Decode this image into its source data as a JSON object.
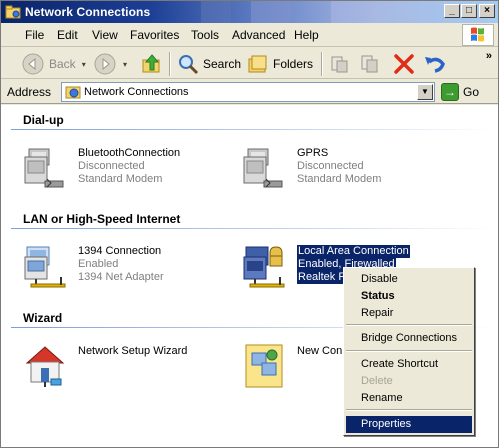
{
  "window": {
    "title": "Network Connections",
    "controls": {
      "minimize": "_",
      "maximize": "□",
      "close": "×"
    }
  },
  "menubar": {
    "items": [
      "File",
      "Edit",
      "View",
      "Favorites",
      "Tools",
      "Advanced",
      "Help"
    ]
  },
  "toolbar": {
    "back_label": "Back",
    "search_label": "Search",
    "folders_label": "Folders",
    "overflow": "»"
  },
  "address": {
    "label": "Address",
    "value": "Network Connections",
    "go_label": "Go"
  },
  "groups": {
    "dialup": {
      "header": "Dial-up",
      "items": [
        {
          "name": "BluetoothConnection",
          "status": "Disconnected",
          "device": "Standard Modem"
        },
        {
          "name": "GPRS",
          "status": "Disconnected",
          "device": "Standard Modem"
        }
      ]
    },
    "lan": {
      "header": "LAN or High-Speed Internet",
      "items": [
        {
          "name": "1394 Connection",
          "status": "Enabled",
          "device": "1394 Net Adapter"
        },
        {
          "name": "Local Area Connection",
          "status": "Enabled, Firewalled",
          "device": "Realtek R"
        }
      ]
    },
    "wizard": {
      "header": "Wizard",
      "items": [
        {
          "name": "Network Setup Wizard"
        },
        {
          "name": "New Conn"
        }
      ]
    }
  },
  "context_menu": {
    "items": [
      {
        "label": "Disable",
        "state": "normal"
      },
      {
        "label": "Status",
        "state": "default"
      },
      {
        "label": "Repair",
        "state": "normal"
      },
      {
        "label": "Bridge Connections",
        "state": "normal"
      },
      {
        "label": "Create Shortcut",
        "state": "normal"
      },
      {
        "label": "Delete",
        "state": "disabled"
      },
      {
        "label": "Rename",
        "state": "normal"
      },
      {
        "label": "Properties",
        "state": "highlighted"
      }
    ]
  },
  "colors": {
    "selection": "#0a246a",
    "title_gradient_start": "#0a246a",
    "group_line": "#7c9ed9",
    "window_bg": "#ece9d8"
  },
  "icons": {
    "title": "network-folder-icon",
    "back": "back-arrow-icon",
    "forward": "forward-arrow-icon",
    "up": "up-folder-icon",
    "search": "search-magnifier-icon",
    "folders": "folders-icon",
    "move_to": "move-to-icon",
    "copy_to": "copy-to-icon",
    "delete": "delete-x-icon",
    "undo": "undo-icon",
    "go": "go-arrow-icon",
    "modem": "modem-computer-icon",
    "lan": "lan-adapter-icon",
    "wizard": "home-network-icon",
    "new_conn": "new-connection-icon"
  }
}
